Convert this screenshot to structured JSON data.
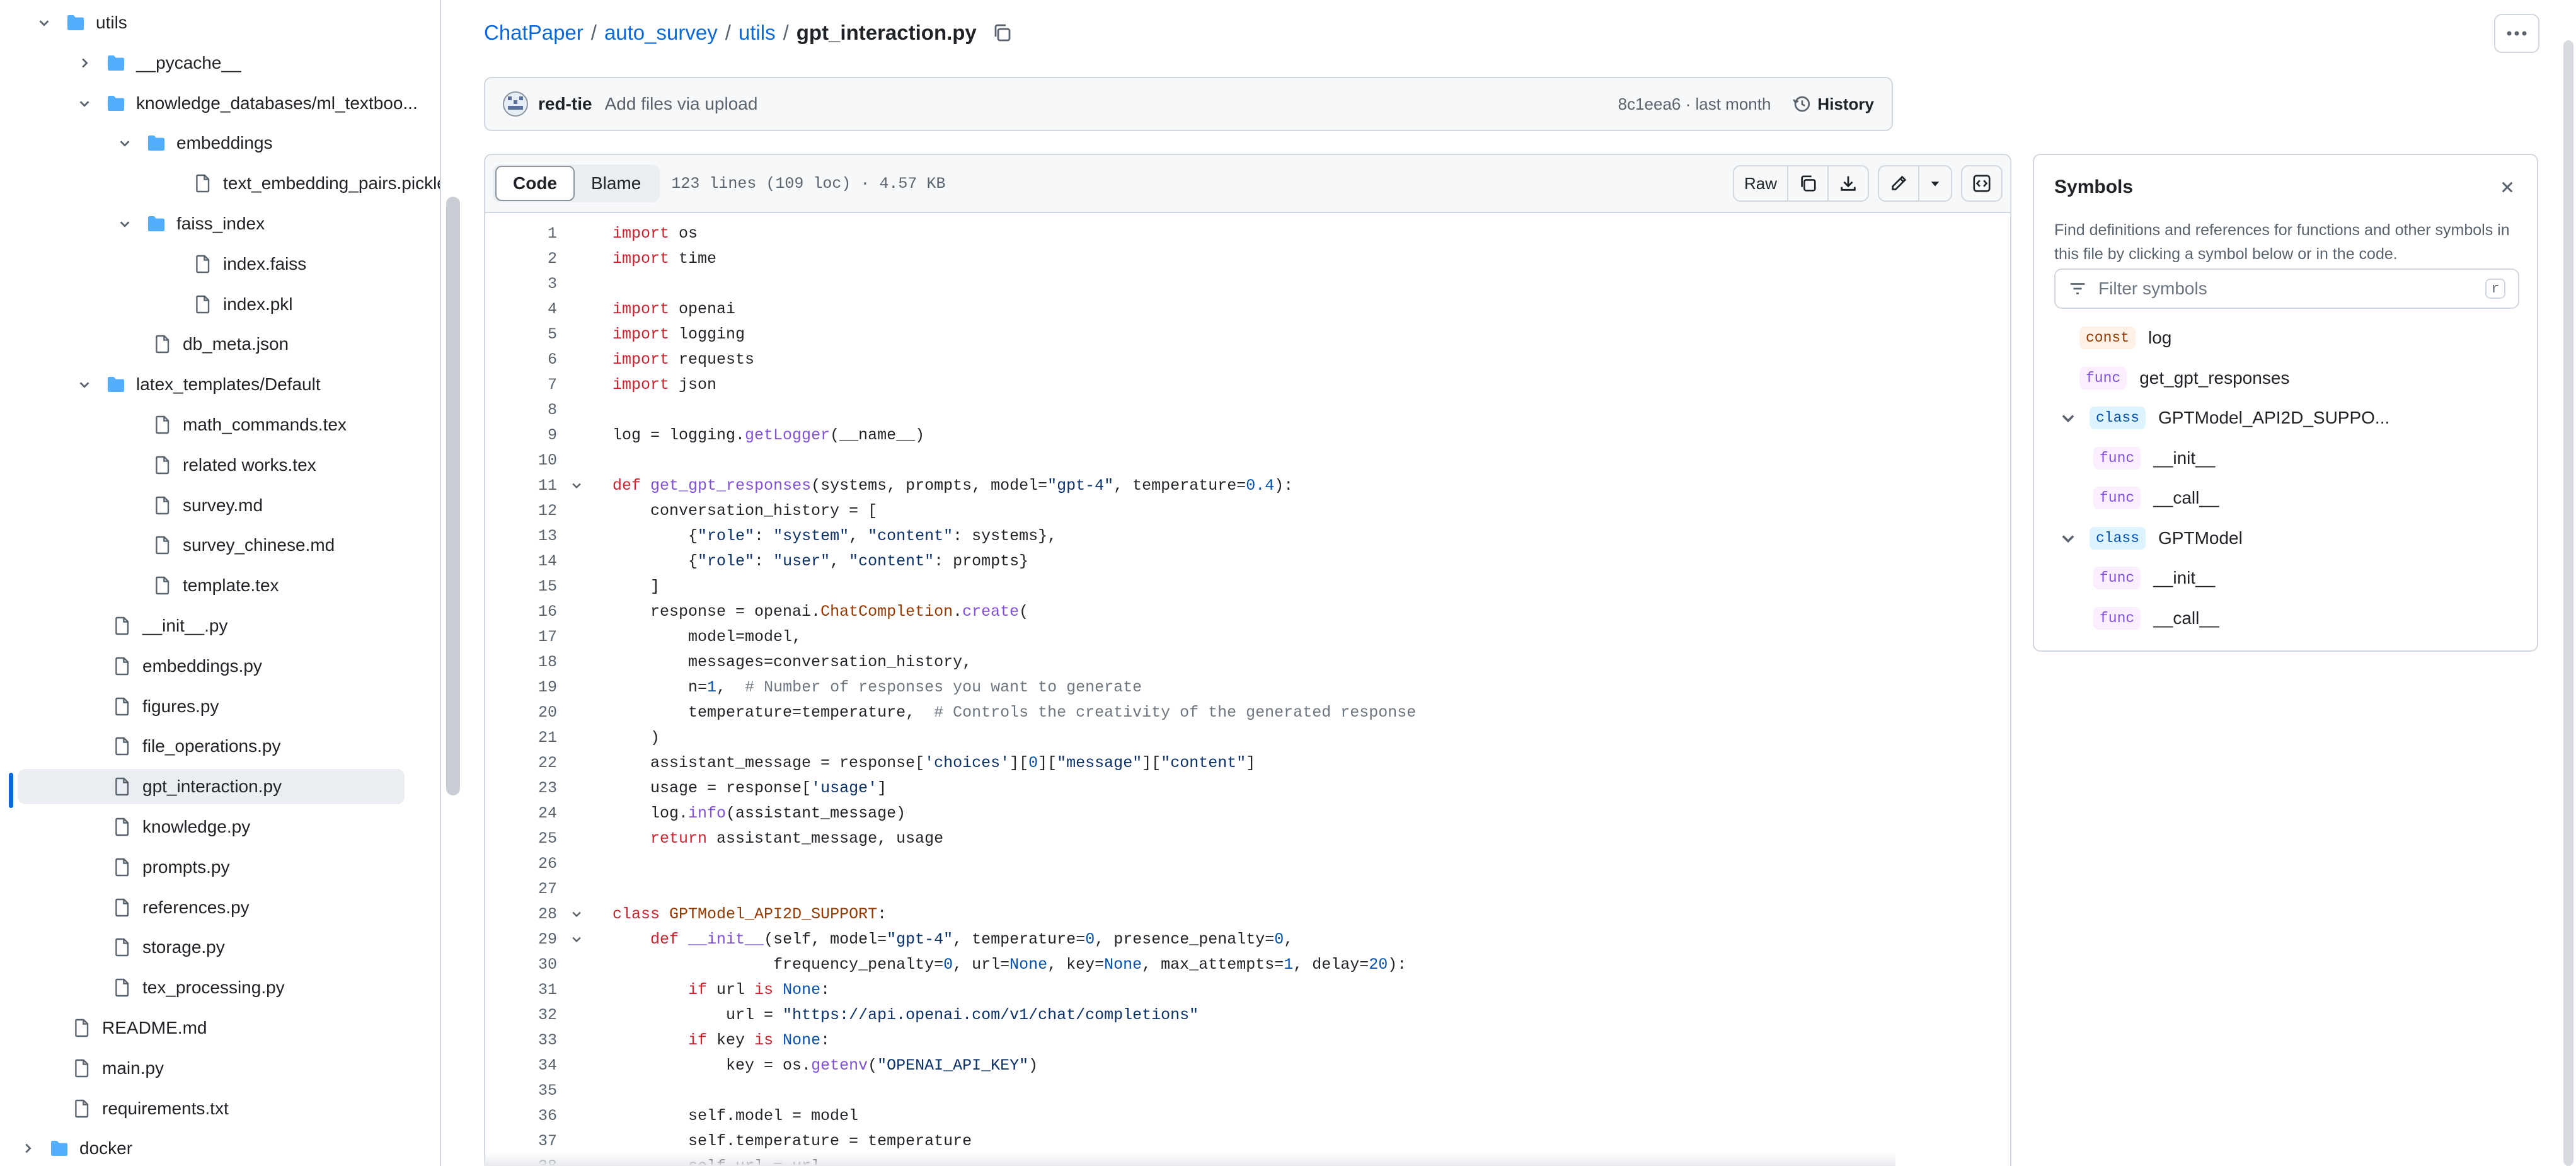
{
  "file_tree": [
    {
      "label": "utils",
      "type": "folder",
      "depth": 0,
      "expanded": true
    },
    {
      "label": "__pycache__",
      "type": "folder",
      "depth": 1,
      "expanded": false
    },
    {
      "label": "knowledge_databases/ml_textboo...",
      "type": "folder",
      "depth": 1,
      "expanded": true
    },
    {
      "label": "embeddings",
      "type": "folder",
      "depth": 2,
      "expanded": true
    },
    {
      "label": "text_embedding_pairs.pickle",
      "type": "file",
      "depth": 3
    },
    {
      "label": "faiss_index",
      "type": "folder",
      "depth": 2,
      "expanded": true
    },
    {
      "label": "index.faiss",
      "type": "file",
      "depth": 3
    },
    {
      "label": "index.pkl",
      "type": "file",
      "depth": 3
    },
    {
      "label": "db_meta.json",
      "type": "file",
      "depth": 2
    },
    {
      "label": "latex_templates/Default",
      "type": "folder",
      "depth": 1,
      "expanded": true
    },
    {
      "label": "math_commands.tex",
      "type": "file",
      "depth": 2
    },
    {
      "label": "related works.tex",
      "type": "file",
      "depth": 2
    },
    {
      "label": "survey.md",
      "type": "file",
      "depth": 2
    },
    {
      "label": "survey_chinese.md",
      "type": "file",
      "depth": 2
    },
    {
      "label": "template.tex",
      "type": "file",
      "depth": 2
    },
    {
      "label": "__init__.py",
      "type": "file",
      "depth": 1
    },
    {
      "label": "embeddings.py",
      "type": "file",
      "depth": 1
    },
    {
      "label": "figures.py",
      "type": "file",
      "depth": 1
    },
    {
      "label": "file_operations.py",
      "type": "file",
      "depth": 1
    },
    {
      "label": "gpt_interaction.py",
      "type": "file",
      "depth": 1,
      "selected": true
    },
    {
      "label": "knowledge.py",
      "type": "file",
      "depth": 1
    },
    {
      "label": "prompts.py",
      "type": "file",
      "depth": 1
    },
    {
      "label": "references.py",
      "type": "file",
      "depth": 1
    },
    {
      "label": "storage.py",
      "type": "file",
      "depth": 1
    },
    {
      "label": "tex_processing.py",
      "type": "file",
      "depth": 1
    },
    {
      "label": "README.md",
      "type": "file",
      "depth": 0
    },
    {
      "label": "main.py",
      "type": "file",
      "depth": 0
    },
    {
      "label": "requirements.txt",
      "type": "file",
      "depth": 0
    },
    {
      "label": "docker",
      "type": "folder",
      "depth": -1,
      "expanded": false
    }
  ],
  "breadcrumb": {
    "repo": "ChatPaper",
    "dir1": "auto_survey",
    "dir2": "utils",
    "file": "gpt_interaction.py",
    "sep": "/"
  },
  "commit": {
    "author": "red-tie",
    "message": "Add files via upload",
    "hash_time": "8c1eea6 · last month",
    "history_label": "History"
  },
  "toolbar": {
    "code_tab": "Code",
    "blame_tab": "Blame",
    "file_info": "123 lines (109 loc) · 4.57 KB",
    "raw_label": "Raw"
  },
  "code_lines": [
    {
      "n": "1",
      "fold": false,
      "html": "<span class=\"kw\">import</span> os"
    },
    {
      "n": "2",
      "fold": false,
      "html": "<span class=\"kw\">import</span> time"
    },
    {
      "n": "3",
      "fold": false,
      "html": ""
    },
    {
      "n": "4",
      "fold": false,
      "html": "<span class=\"kw\">import</span> openai"
    },
    {
      "n": "5",
      "fold": false,
      "html": "<span class=\"kw\">import</span> logging"
    },
    {
      "n": "6",
      "fold": false,
      "html": "<span class=\"kw\">import</span> requests"
    },
    {
      "n": "7",
      "fold": false,
      "html": "<span class=\"kw\">import</span> json"
    },
    {
      "n": "8",
      "fold": false,
      "html": ""
    },
    {
      "n": "9",
      "fold": false,
      "html": "log = logging.<span class=\"fn\">getLogger</span>(__name__)"
    },
    {
      "n": "10",
      "fold": false,
      "html": ""
    },
    {
      "n": "11",
      "fold": true,
      "html": "<span class=\"kw\">def</span> <span class=\"fn\">get_gpt_responses</span>(systems, prompts, model=<span class=\"str\">\"gpt-4\"</span>, temperature=<span class=\"num\">0.4</span>):"
    },
    {
      "n": "12",
      "fold": false,
      "html": "    conversation_history = ["
    },
    {
      "n": "13",
      "fold": false,
      "html": "        {<span class=\"str\">\"role\"</span>: <span class=\"str\">\"system\"</span>, <span class=\"str\">\"content\"</span>: systems},"
    },
    {
      "n": "14",
      "fold": false,
      "html": "        {<span class=\"str\">\"role\"</span>: <span class=\"str\">\"user\"</span>, <span class=\"str\">\"content\"</span>: prompts}"
    },
    {
      "n": "15",
      "fold": false,
      "html": "    ]"
    },
    {
      "n": "16",
      "fold": false,
      "html": "    response = openai.<span class=\"cls\">ChatCompletion</span>.<span class=\"fn\">create</span>("
    },
    {
      "n": "17",
      "fold": false,
      "html": "        model=model,"
    },
    {
      "n": "18",
      "fold": false,
      "html": "        messages=conversation_history,"
    },
    {
      "n": "19",
      "fold": false,
      "html": "        n=<span class=\"num\">1</span>,  <span class=\"com\"># Number of responses you want to generate</span>"
    },
    {
      "n": "20",
      "fold": false,
      "html": "        temperature=temperature,  <span class=\"com\"># Controls the creativity of the generated response</span>"
    },
    {
      "n": "21",
      "fold": false,
      "html": "    )"
    },
    {
      "n": "22",
      "fold": false,
      "html": "    assistant_message = response[<span class=\"str\">'choices'</span>][<span class=\"num\">0</span>][<span class=\"str\">\"message\"</span>][<span class=\"str\">\"content\"</span>]"
    },
    {
      "n": "23",
      "fold": false,
      "html": "    usage = response[<span class=\"str\">'usage'</span>]"
    },
    {
      "n": "24",
      "fold": false,
      "html": "    log.<span class=\"fn\">info</span>(assistant_message)"
    },
    {
      "n": "25",
      "fold": false,
      "html": "    <span class=\"kw\">return</span> assistant_message, usage"
    },
    {
      "n": "26",
      "fold": false,
      "html": ""
    },
    {
      "n": "27",
      "fold": false,
      "html": ""
    },
    {
      "n": "28",
      "fold": true,
      "html": "<span class=\"kw\">class</span> <span class=\"cls\">GPTModel_API2D_SUPPORT</span>:"
    },
    {
      "n": "29",
      "fold": true,
      "html": "    <span class=\"kw\">def</span> <span class=\"fn\">__init__</span>(self, model=<span class=\"str\">\"gpt-4\"</span>, temperature=<span class=\"num\">0</span>, presence_penalty=<span class=\"num\">0</span>,"
    },
    {
      "n": "30",
      "fold": false,
      "html": "                 frequency_penalty=<span class=\"num\">0</span>, url=<span class=\"num\">None</span>, key=<span class=\"num\">None</span>, max_attempts=<span class=\"num\">1</span>, delay=<span class=\"num\">20</span>):"
    },
    {
      "n": "31",
      "fold": false,
      "html": "        <span class=\"kw\">if</span> url <span class=\"kw\">is</span> <span class=\"num\">None</span>:"
    },
    {
      "n": "32",
      "fold": false,
      "html": "            url = <span class=\"str\">\"https://api.openai.com/v1/chat/completions\"</span>"
    },
    {
      "n": "33",
      "fold": false,
      "html": "        <span class=\"kw\">if</span> key <span class=\"kw\">is</span> <span class=\"num\">None</span>:"
    },
    {
      "n": "34",
      "fold": false,
      "html": "            key = os.<span class=\"fn\">getenv</span>(<span class=\"str\">\"OPENAI_API_KEY\"</span>)"
    },
    {
      "n": "35",
      "fold": false,
      "html": ""
    },
    {
      "n": "36",
      "fold": false,
      "html": "        self.model = model"
    },
    {
      "n": "37",
      "fold": false,
      "html": "        self.temperature = temperature"
    },
    {
      "n": "38",
      "fold": false,
      "html": "        self.url = url"
    }
  ],
  "symbols": {
    "title": "Symbols",
    "description": "Find definitions and references for functions and other symbols in this file by clicking a symbol below or in the code.",
    "filter_placeholder": "Filter symbols",
    "filter_shortcut": "r",
    "items": [
      {
        "kind": "const",
        "name": "log",
        "indent": 0,
        "chevron": false
      },
      {
        "kind": "func",
        "name": "get_gpt_responses",
        "indent": 0,
        "chevron": false
      },
      {
        "kind": "class",
        "name": "GPTModel_API2D_SUPPO...",
        "indent": 0,
        "chevron": true
      },
      {
        "kind": "func",
        "name": "__init__",
        "indent": 1,
        "chevron": false
      },
      {
        "kind": "func",
        "name": "__call__",
        "indent": 1,
        "chevron": false
      },
      {
        "kind": "class",
        "name": "GPTModel",
        "indent": 0,
        "chevron": true
      },
      {
        "kind": "func",
        "name": "__init__",
        "indent": 1,
        "chevron": false
      },
      {
        "kind": "func",
        "name": "__call__",
        "indent": 1,
        "chevron": false
      }
    ]
  },
  "colors": {
    "accent": "#0969da",
    "folder": "#54aeff",
    "border": "#d0d7de"
  }
}
